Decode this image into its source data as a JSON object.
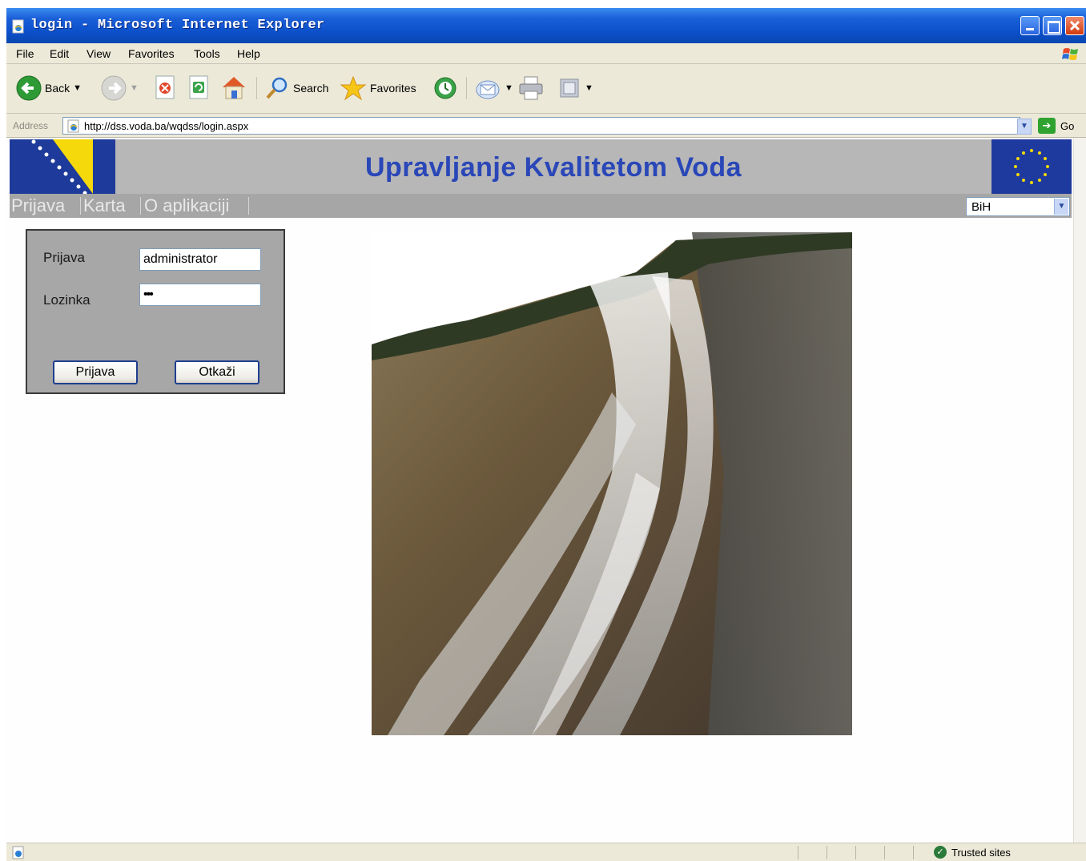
{
  "window": {
    "title": "login - Microsoft Internet Explorer"
  },
  "menubar": {
    "items": [
      "File",
      "Edit",
      "View",
      "Favorites",
      "Tools",
      "Help"
    ]
  },
  "toolbar": {
    "back_label": "Back",
    "search_label": "Search",
    "favorites_label": "Favorites"
  },
  "addressbar": {
    "label": "Address",
    "url": "http://dss.voda.ba/wqdss/login.aspx",
    "go_label": "Go"
  },
  "page": {
    "banner_title": "Upravljanje Kvalitetom Voda",
    "nav": [
      "Prijava",
      "Karta",
      "O aplikaciji"
    ],
    "region_select": {
      "value": "BiH"
    },
    "login": {
      "username_label": "Prijava",
      "username_value": "administrator",
      "password_label": "Lozinka",
      "password_value": "•••",
      "submit_label": "Prijava",
      "cancel_label": "Otkaži"
    }
  },
  "statusbar": {
    "zone_text": "Trusted sites"
  },
  "icons": {
    "back": "back-arrow-icon",
    "forward": "forward-arrow-icon",
    "stop": "stop-icon",
    "refresh": "refresh-icon",
    "home": "home-icon",
    "search": "search-icon",
    "favorites": "favorites-star-icon",
    "history": "history-icon",
    "mail": "mail-icon",
    "print": "print-icon",
    "edit": "edit-icon",
    "go": "go-arrow-icon",
    "zone": "trusted-sites-icon"
  },
  "colors": {
    "titlebar": "#0b4fc9",
    "banner_background": "#b7b7b7",
    "banner_title": "#2a47b8",
    "nav_strip": "#a6a6a6",
    "login_panel": "#a7a7a7",
    "eu_flag_blue": "#1f3a9e",
    "ba_flag_yellow": "#f5d90a"
  }
}
